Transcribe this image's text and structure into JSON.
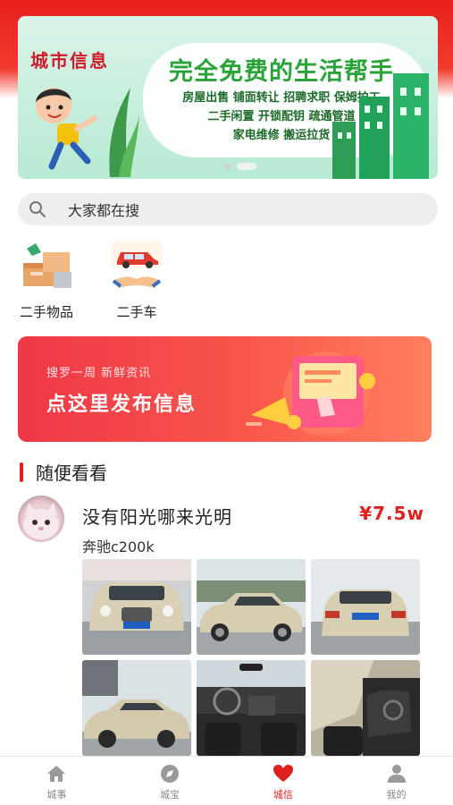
{
  "banner": {
    "brand": "城市信息",
    "headline": "完全免费的生活帮手",
    "lines": [
      "房屋出售 铺面转让 招聘求职 保姆护工",
      "二手闲置 开锁配钥 疏通管道",
      "家电维修 搬运拉货"
    ],
    "page_count": 2,
    "active_page": 2
  },
  "search": {
    "placeholder": "大家都在搜"
  },
  "categories": [
    {
      "label": "二手物品",
      "icon": "boxes-icon"
    },
    {
      "label": "二手车",
      "icon": "car-handshake-icon"
    }
  ],
  "publish": {
    "subtitle": "搜罗一周  新鲜资讯",
    "title": "点这里发布信息"
  },
  "section": {
    "title": "随便看看"
  },
  "post": {
    "title": "没有阳光哪来光明",
    "price": "¥7.5w",
    "description": "奔驰c200k",
    "photo_count": 6
  },
  "tabbar": {
    "items": [
      {
        "label": "城事",
        "icon": "home-icon"
      },
      {
        "label": "城宝",
        "icon": "compass-icon"
      },
      {
        "label": "城信",
        "icon": "heart-icon"
      },
      {
        "label": "我的",
        "icon": "user-icon"
      }
    ],
    "active_index": 2
  },
  "colors": {
    "accent": "#e0201e",
    "banner_green": "#2aa339"
  }
}
